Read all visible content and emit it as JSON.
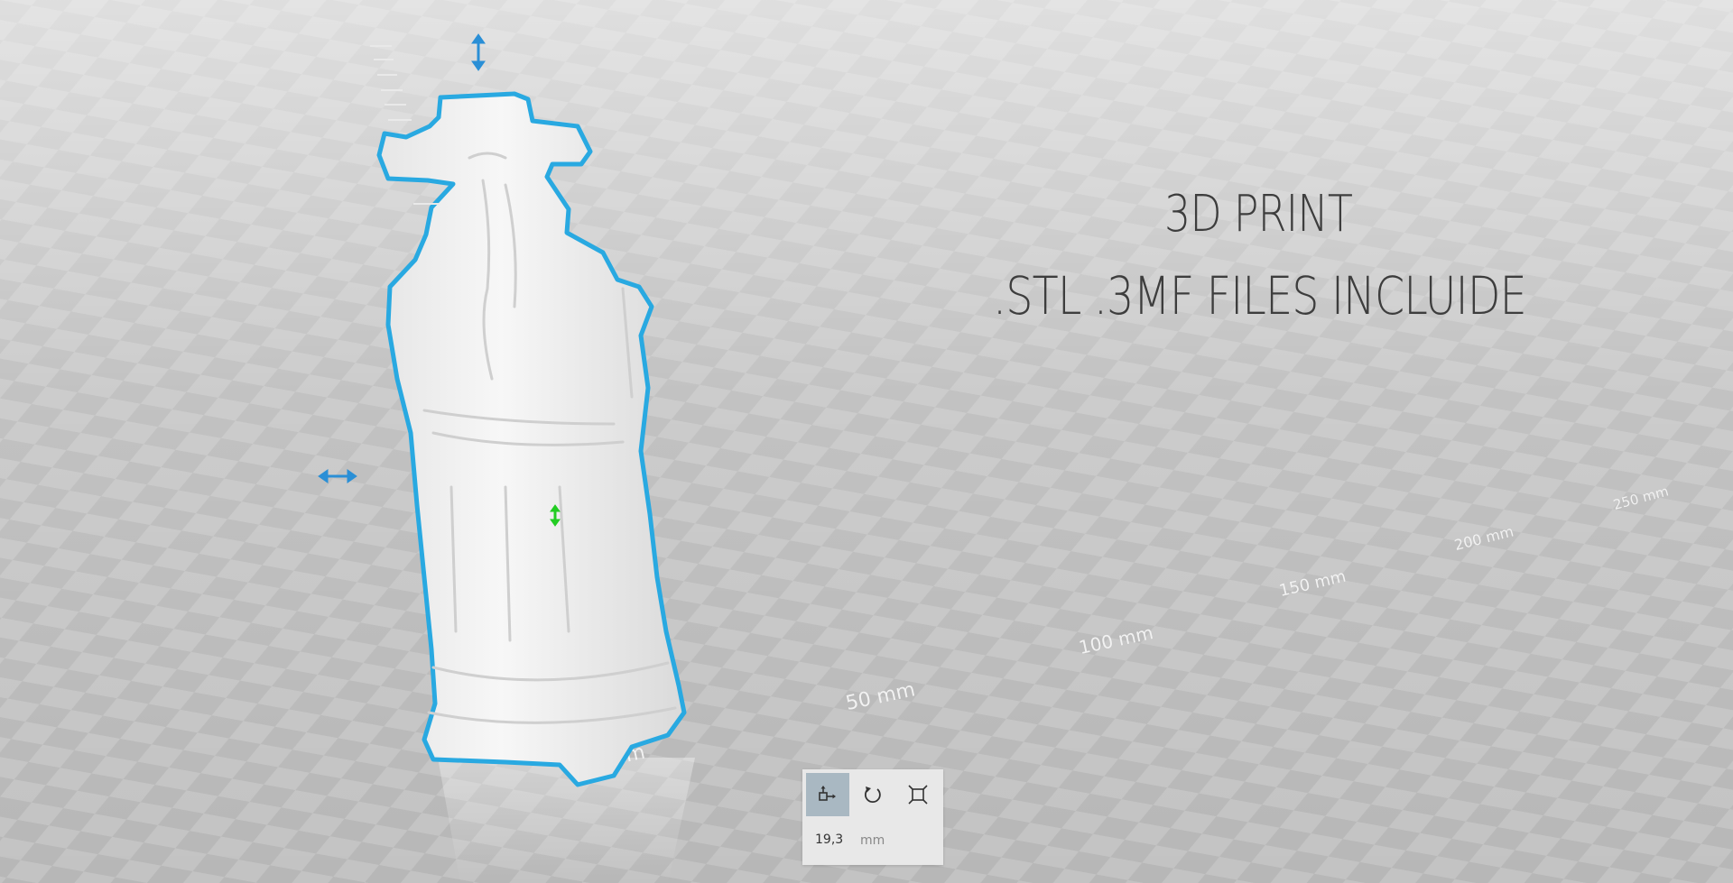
{
  "promo": {
    "line1": "3D PRINT",
    "line2": ".STL .3MF FILES INCLUIDE"
  },
  "ruler": {
    "labels": [
      "mm",
      "50 mm",
      "100 mm",
      "150 mm",
      "200 mm",
      "250 mm"
    ]
  },
  "toolbox": {
    "tools": [
      "move-tool",
      "rotate-tool",
      "scale-tool"
    ],
    "active_tool": "move-tool",
    "size_value": "19,3",
    "size_unit": "mm"
  },
  "colors": {
    "selection_outline": "#29a9e1",
    "gizmo_blue": "#2a8fd6",
    "gizmo_green": "#22cc22",
    "active_tool_bg": "#a9b8c2"
  },
  "icons": {
    "vertical_drag_handle": "double-arrow-vertical-icon",
    "horizontal_drag_handle": "double-arrow-horizontal-icon",
    "center_handle": "double-arrow-green-icon"
  }
}
